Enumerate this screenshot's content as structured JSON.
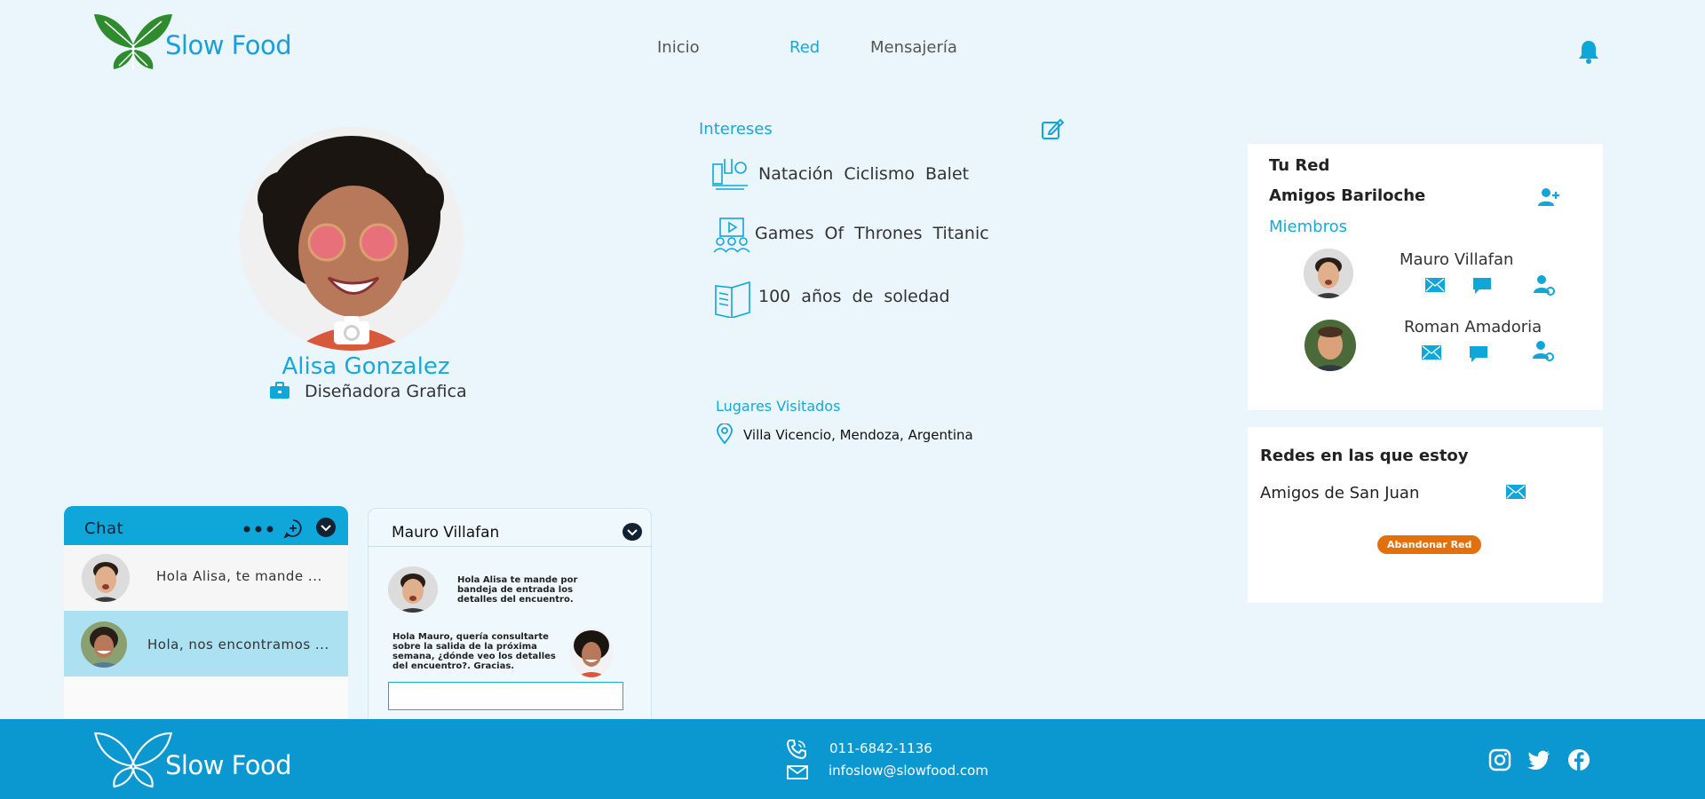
{
  "header": {
    "brand": "Slow Food",
    "nav": [
      {
        "label": "Inicio"
      },
      {
        "label": "Red"
      },
      {
        "label": "Mensajería"
      }
    ],
    "bell_icon": "bell-icon"
  },
  "profile": {
    "name": "Alisa Gonzalez",
    "role": "Diseñadora Grafica"
  },
  "interests": {
    "title": "Intereses",
    "items": [
      {
        "icon": "sports-icon",
        "text": "Natación  Ciclismo  Balet"
      },
      {
        "icon": "movies-icon",
        "text": "Games Of Thrones  Titanic"
      },
      {
        "icon": "book-icon",
        "text": "100 años de soledad"
      }
    ]
  },
  "places": {
    "title": "Lugares Visitados",
    "items": [
      "Villa Vicencio, Mendoza, Argentina"
    ]
  },
  "network": {
    "title": "Tu Red",
    "group": "Amigos Bariloche",
    "members_title": "Miembros",
    "members": [
      {
        "name": "Mauro Villafan"
      },
      {
        "name": "Roman Amadoria"
      }
    ]
  },
  "networks_in": {
    "title": "Redes en las que estoy",
    "items": [
      "Amigos de San Juan"
    ],
    "leave_label": "Abandonar Red"
  },
  "chat": {
    "title": "Chat",
    "items": [
      {
        "preview": "Hola Alisa, te mande ..."
      },
      {
        "preview": "Hola, nos encontramos ..."
      }
    ]
  },
  "conversation": {
    "contact": "Mauro Villafan",
    "messages": [
      {
        "from": "Mauro",
        "text": "Hola Alisa te mande por bandeja de entrada los detalles del encuentro."
      },
      {
        "from": "Alisa",
        "text": "Hola Mauro, quería consultarte sobre la salida de la próxima semana, ¿dónde veo los detalles del encuentro?. Gracias."
      }
    ],
    "input_value": ""
  },
  "footer": {
    "brand": "Slow Food",
    "phone": "011-6842-1136",
    "email": "infoslow@slowfood.com"
  },
  "colors": {
    "accent": "#19a8d8",
    "footer": "#0b98d0",
    "leave_button": "#e2700c",
    "background": "#eaf6fc"
  }
}
